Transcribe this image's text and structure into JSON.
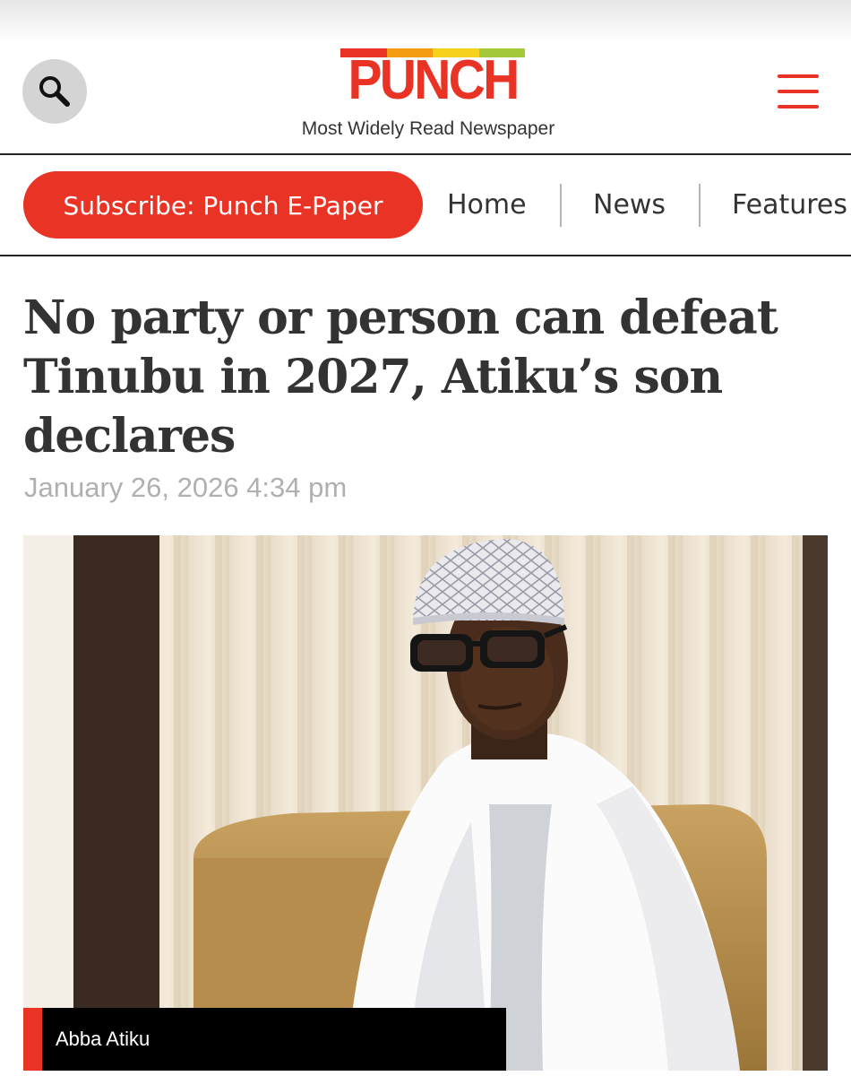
{
  "brand": {
    "logo_text": "PUNCH",
    "tagline": "Most Widely Read Newspaper",
    "logo_bar_colors": [
      "#e83325",
      "#f39c12",
      "#f7d21c",
      "#a4c93a"
    ],
    "accent_color": "#e83325"
  },
  "header": {
    "search_icon": "search-icon",
    "menu_icon": "hamburger-menu-icon"
  },
  "nav": {
    "subscribe_label": "Subscribe: Punch E-Paper",
    "links": [
      "Home",
      "News",
      "Features"
    ]
  },
  "article": {
    "headline": "No party or person can defeat Tinubu in 2027, Atiku’s son declares",
    "timestamp": "January 26, 2026 4:34 pm",
    "image_caption": "Abba Atiku"
  }
}
